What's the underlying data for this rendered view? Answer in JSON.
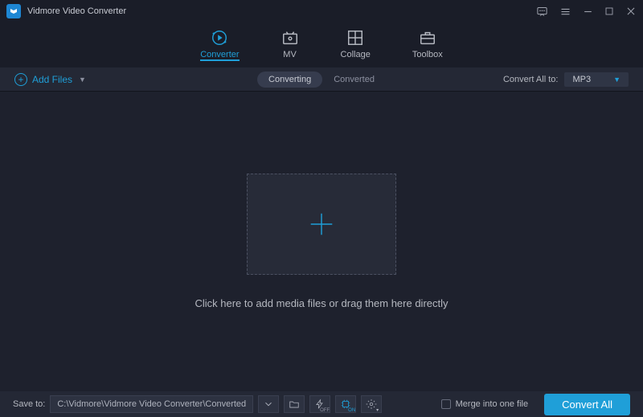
{
  "app": {
    "title": "Vidmore Video Converter"
  },
  "nav": {
    "converter": "Converter",
    "mv": "MV",
    "collage": "Collage",
    "toolbox": "Toolbox"
  },
  "toolbar": {
    "add_files": "Add Files",
    "tab_converting": "Converting",
    "tab_converted": "Converted",
    "convert_all_to": "Convert All to:",
    "format": "MP3"
  },
  "content": {
    "hint": "Click here to add media files or drag them here directly"
  },
  "bottom": {
    "save_to_label": "Save to:",
    "path": "C:\\Vidmore\\Vidmore Video Converter\\Converted",
    "merge_label": "Merge into one file",
    "convert_btn": "Convert All"
  }
}
